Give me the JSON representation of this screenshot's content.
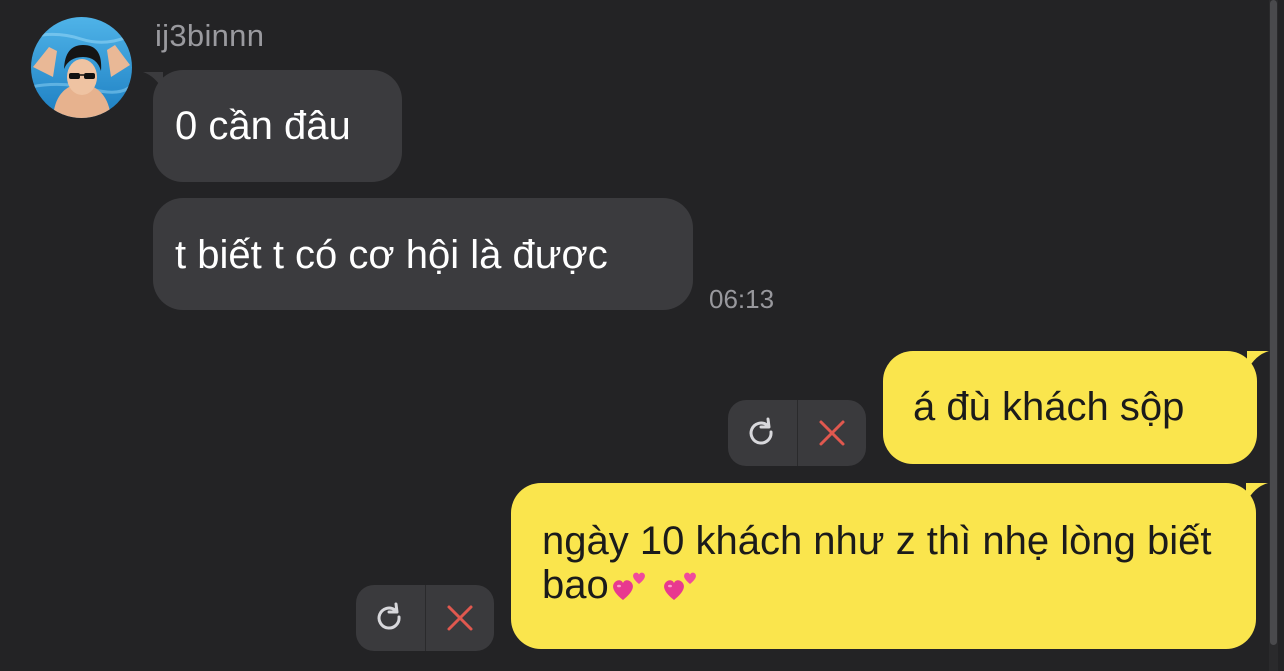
{
  "sender": {
    "name": "ij3binnn"
  },
  "incoming_messages": [
    {
      "text": "0 cần đâu"
    },
    {
      "text": "t biết t có cơ hội là được"
    }
  ],
  "incoming_timestamp": "06:13",
  "outgoing_messages": [
    {
      "text": "á đù khách sộp",
      "status": "failed"
    },
    {
      "text": "ngày 10 khách như z thì nhẹ lòng biết bao",
      "emojis": [
        "revolving-hearts",
        "revolving-hearts"
      ],
      "status": "failed"
    }
  ],
  "actions": {
    "retry_icon": "retry-icon",
    "delete_icon": "close-icon"
  },
  "colors": {
    "background": "#232325",
    "incoming_bubble": "#3b3b3e",
    "outgoing_bubble": "#fae54d",
    "delete_red": "#e0584f"
  }
}
